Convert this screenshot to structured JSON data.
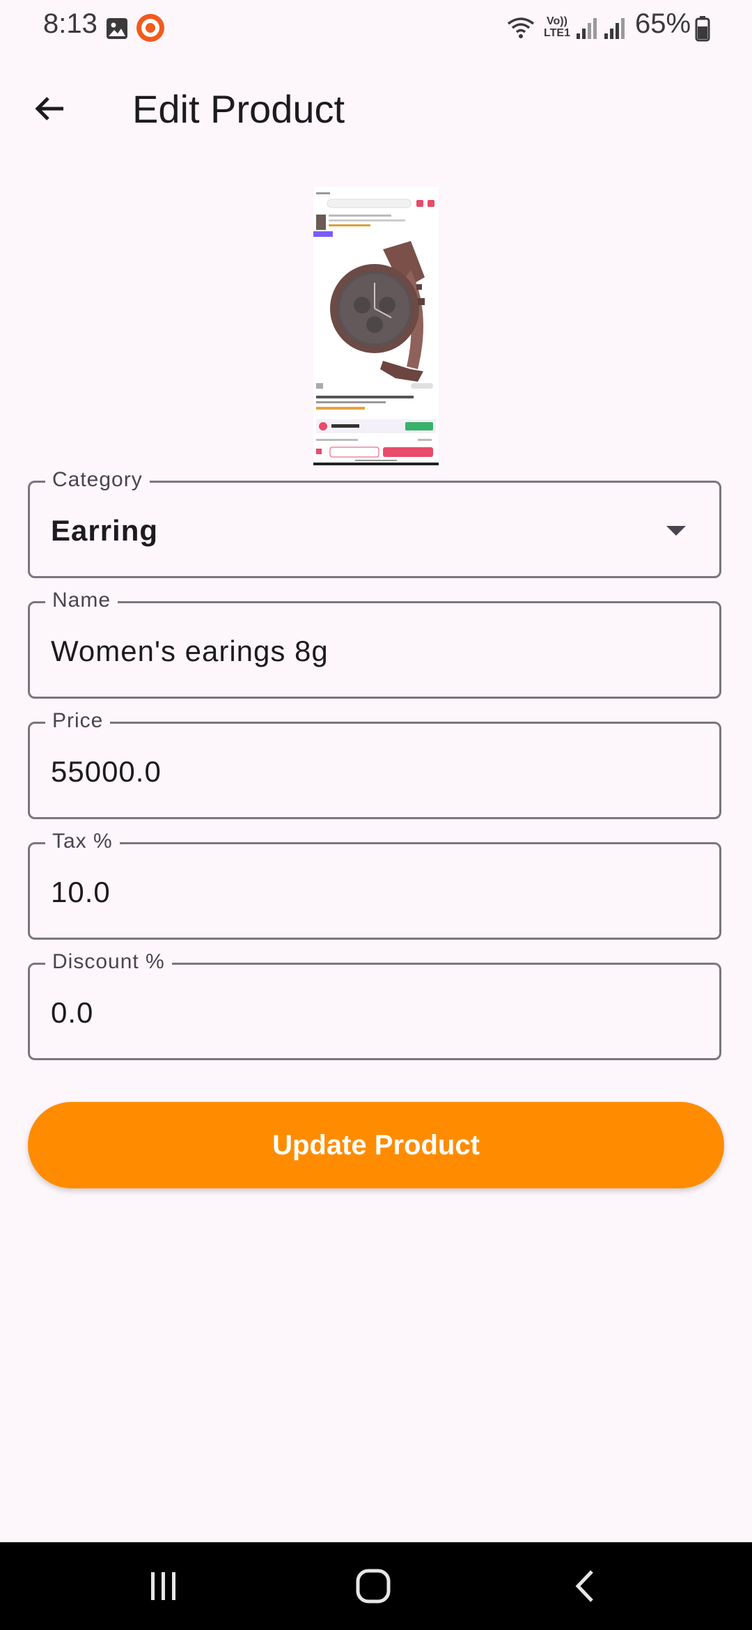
{
  "status_bar": {
    "time": "8:13",
    "network_label": "Vo)) LTE1",
    "battery": "65%"
  },
  "app_bar": {
    "title": "Edit Product",
    "back_icon": "arrow-back-icon"
  },
  "product_image": {
    "subject": "brown wrist watch"
  },
  "form": {
    "category": {
      "label": "Category",
      "value": "Earring"
    },
    "name": {
      "label": "Name",
      "value": "Women's earings 8g"
    },
    "price": {
      "label": "Price",
      "value": "55000.0"
    },
    "tax": {
      "label": "Tax %",
      "value": "10.0"
    },
    "discount": {
      "label": "Discount %",
      "value": "0.0"
    }
  },
  "update_button": {
    "label": "Update Product"
  },
  "colors": {
    "background": "#fdf6fb",
    "accent": "#ff8c00",
    "outline": "#7a757f"
  },
  "nav_bar": {
    "icons": [
      "recents-icon",
      "home-icon",
      "back-icon"
    ]
  }
}
